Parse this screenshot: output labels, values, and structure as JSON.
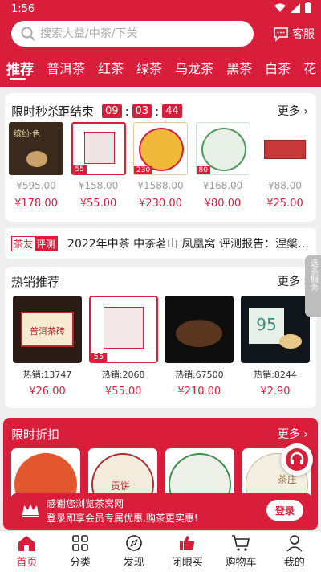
{
  "status": {
    "time": "1:56"
  },
  "search": {
    "placeholder": "搜索大益/中茶/下关"
  },
  "service_label": "客服",
  "tabs": [
    "推荐",
    "普洱茶",
    "红茶",
    "绿茶",
    "乌龙茶",
    "黑茶",
    "白茶",
    "花"
  ],
  "flash": {
    "title": "限时秒杀",
    "countdown_label": "距结束",
    "h": "09",
    "m": "03",
    "s": "44",
    "more": "更多",
    "items": [
      {
        "old": "¥595.00",
        "price": "¥178.00",
        "img": "缤纷·色"
      },
      {
        "old": "¥158.00",
        "price": "¥55.00",
        "badge": "55"
      },
      {
        "old": "¥1588.00",
        "price": "¥230.00",
        "badge": "230"
      },
      {
        "old": "¥168.00",
        "price": "¥80.00",
        "badge": "80"
      },
      {
        "old": "¥88.00",
        "price": "¥25.00"
      }
    ]
  },
  "news": {
    "tag_a": "茶友",
    "tag_b": "评测",
    "text": "2022年中茶 中茶茗山 凤凰窝 评测报告：涅槃…"
  },
  "hot": {
    "title": "热销推荐",
    "more": "更多",
    "items": [
      {
        "sales": "热销:13747",
        "price": "¥26.00",
        "label": "普洱茶砖"
      },
      {
        "sales": "热销:2068",
        "price": "¥55.00",
        "badge": "55"
      },
      {
        "sales": "热销:67500",
        "price": "¥210.00"
      },
      {
        "sales": "热销:8244",
        "price": "¥2.90",
        "label": "95"
      }
    ]
  },
  "discount": {
    "title": "限时折扣",
    "more": "更多",
    "labels": [
      "",
      "贡饼",
      "",
      "茶庄"
    ]
  },
  "login_bar": {
    "line1": "感谢您浏览茶窝网",
    "line2": "登录即享会员专属优惠,购茶更实惠!",
    "button": "登录"
  },
  "side_tab": "选茶服务",
  "nav": [
    {
      "label": "首页",
      "icon": "home-icon"
    },
    {
      "label": "分类",
      "icon": "grid-icon"
    },
    {
      "label": "发现",
      "icon": "compass-icon"
    },
    {
      "label": "闭眼买",
      "icon": "thumbs-up-icon"
    },
    {
      "label": "购物车",
      "icon": "cart-icon"
    },
    {
      "label": "我的",
      "icon": "user-icon"
    }
  ],
  "colors": {
    "brand": "#d81e3a",
    "background": "#efefef"
  }
}
